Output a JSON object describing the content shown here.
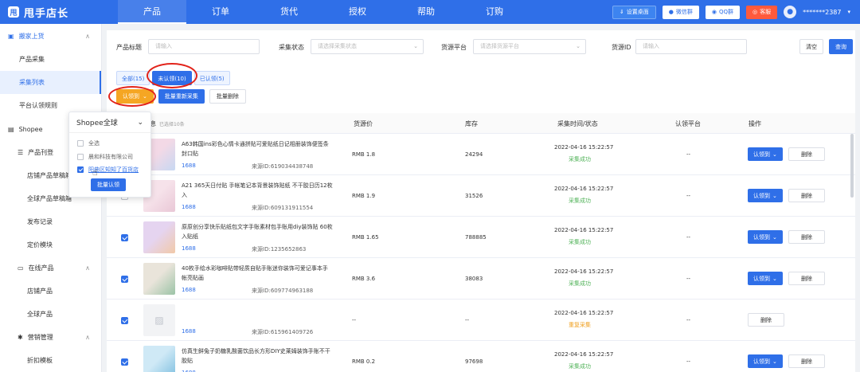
{
  "brand": {
    "logo_glyph": "甩",
    "name": "甩手店长"
  },
  "nav": [
    "产品",
    "订单",
    "货代",
    "授权",
    "帮助",
    "订购"
  ],
  "top_actions": {
    "desktop": "设置桌面",
    "wechat": "微信群",
    "qq": "QQ群",
    "service": "客服",
    "username": "*******2387"
  },
  "sidebar": {
    "group1": "搬家上货",
    "group1_items": [
      "产品采集",
      "采集列表",
      "平台认领规则"
    ],
    "group2": "Shopee",
    "sub1": "产品刊登",
    "sub1_items": [
      "店铺产品草稿箱",
      "全球产品草稿箱",
      "发布记录",
      "定价模块"
    ],
    "sub2": "在线产品",
    "sub2_items": [
      "店铺产品",
      "全球产品"
    ],
    "sub3": "营销管理",
    "sub3_items": [
      "折扣模板"
    ]
  },
  "filters": {
    "title_label": "产品标题",
    "title_placeholder": "请输入",
    "status_label": "采集状态",
    "status_placeholder": "请选择采集状态",
    "platform_label": "货源平台",
    "platform_placeholder": "请选择货源平台",
    "id_label": "货源ID",
    "id_placeholder": "请输入",
    "clear": "清空",
    "search": "查询"
  },
  "status_tabs": [
    "全部(15)",
    "未认领(10)",
    "已认领(5)"
  ],
  "actions": {
    "claim": "认领到",
    "recollect": "批量重新采集",
    "batch_delete": "批量删除"
  },
  "table": {
    "headers": {
      "info": "信息",
      "selected": "已选择10条",
      "price": "货源价",
      "stock": "库存",
      "time": "采集时间/状态",
      "platform": "认领平台",
      "ops": "操作"
    },
    "claim_label": "认领到",
    "delete_label": "删除",
    "rows": [
      {
        "checked": false,
        "title": "A63韩国ins彩色心情卡通拼贴可爱贴纸日记相册装饰便签条封口贴",
        "source": "1688",
        "id": "来源ID:619034438748",
        "price": "RMB 1.8",
        "stock": "24294",
        "time": "2022-04-16 15:22:57",
        "state": "采集成功",
        "platform": "--"
      },
      {
        "checked": false,
        "title": "A21 365天日付贴 手帐笔记本背景装饰贴纸 不干胶日历12枚入",
        "source": "1688",
        "id": "来源ID:609131911554",
        "price": "RMB 1.9",
        "stock": "31526",
        "time": "2022-04-16 15:22:57",
        "state": "采集成功",
        "platform": "--"
      },
      {
        "checked": true,
        "title": "原原创分享快乐贴纸包文字手账素材包手账用diy装饰贴 60枚入贴纸",
        "source": "1688",
        "id": "来源ID:1235652863",
        "price": "RMB 1.65",
        "stock": "788885",
        "time": "2022-04-16 15:22:57",
        "state": "采集成功",
        "platform": "--"
      },
      {
        "checked": true,
        "title": "40枚手绘水彩咖啡贴带轻质自贴手账迷你装饰可爱记事本手帐亮贴画",
        "source": "1688",
        "id": "来源ID:609774963188",
        "price": "RMB 3.6",
        "stock": "38083",
        "time": "2022-04-16 15:22:57",
        "state": "采集成功",
        "platform": "--"
      },
      {
        "checked": true,
        "title": "",
        "source": "1688",
        "id": "来源ID:615961409726",
        "price": "--",
        "stock": "--",
        "time": "2022-04-16 15:22:57",
        "state": "重复采集",
        "platform": "--"
      },
      {
        "checked": true,
        "title": "仿真生鲜兔子奶糖乳酸菌饮品长方形DIY史莱姆装饰手账不干胶贴",
        "source": "1688",
        "id": "",
        "price": "RMB 0.2",
        "stock": "97698",
        "time": "2022-04-16 15:22:57",
        "state": "采集成功",
        "platform": "--"
      }
    ]
  },
  "popup": {
    "title": "Shopee全球",
    "select_all": "全选",
    "option1": "晨和科技有限公司",
    "option2": "阳曲区知知了百货店",
    "batch_claim": "批量认领"
  },
  "colors": {
    "primary": "#2f6fe8",
    "success": "#52b35a",
    "warning": "#f0a020",
    "orange": "#f5a623",
    "red": "#ff5a3c"
  }
}
